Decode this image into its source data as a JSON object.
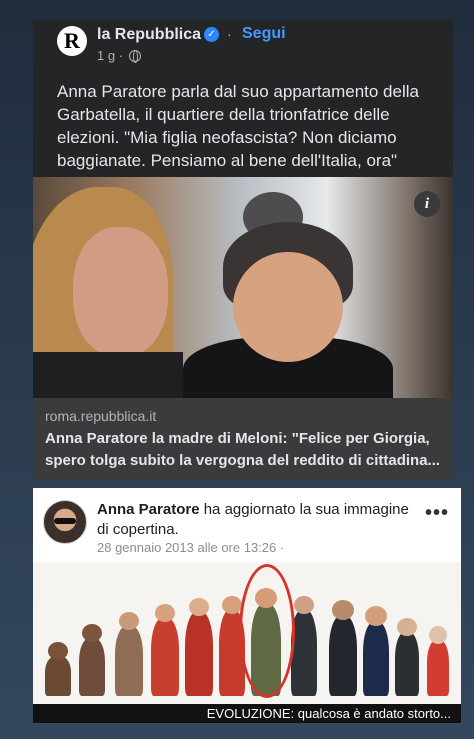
{
  "post": {
    "page_name": "la Repubblica",
    "logo_letter": "R",
    "separator": "·",
    "follow_label": "Segui",
    "time": "1 g ·",
    "text": "Anna Paratore parla dal suo appartamento della Garbatella, il quartiere della trionfatrice delle elezioni. \"Mia figlia neofascista? Non diciamo baggianate. Pensiamo al bene dell'Italia, ora\"",
    "info_icon_label": "i",
    "link": {
      "domain": "roma.repubblica.it",
      "title": "Anna Paratore la madre di Meloni: \"Felice per Giorgia, spero tolga subito la vergogna del reddito di cittadina..."
    }
  },
  "screenshot2": {
    "author": "Anna Paratore",
    "action": " ha aggiornato la sua immagine di copertina.",
    "date": "28 gennaio 2013 alle ore 13:26 ·",
    "more_label": "•••",
    "caption": "EVOLUZIONE: qualcosa è andato storto..."
  },
  "colors": {
    "accent": "#4599ff",
    "verified": "#2d88ff",
    "highlight_circle": "#d4342a"
  },
  "icons": [
    "globe-icon",
    "verified-icon",
    "info-icon",
    "more-icon"
  ]
}
